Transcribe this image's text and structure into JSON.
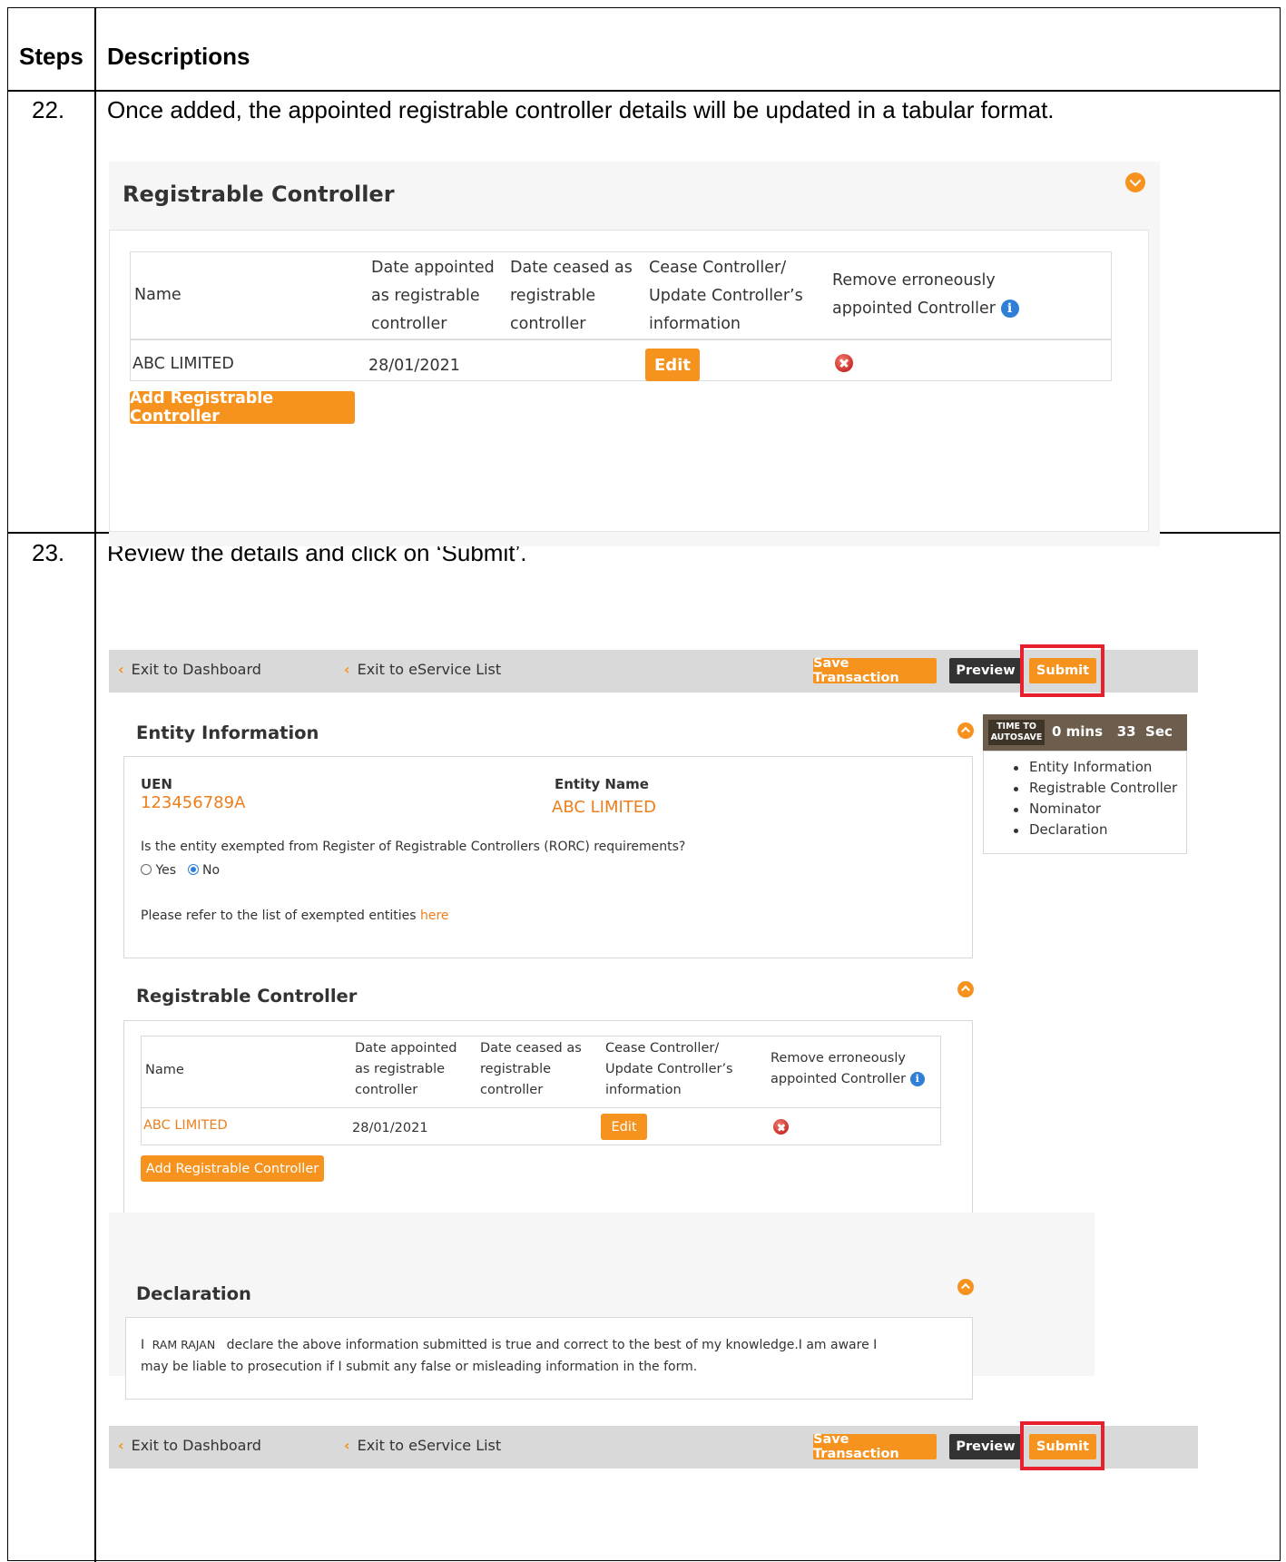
{
  "table": {
    "header_steps": "Steps",
    "header_descriptions": "Descriptions",
    "rows": [
      {
        "step": "22.",
        "description": "Once added, the appointed registrable controller details will be updated in a tabular format."
      },
      {
        "step": "23.",
        "description": "Review the details and click on ‘Submit’."
      }
    ]
  },
  "icons": {
    "collapse": "chevron-circle-icon",
    "remove": "red-cross-icon",
    "info": "info-icon",
    "nav": "chevron-left-icon"
  },
  "colors": {
    "accent": "#f6931e",
    "link": "#ec7f1d",
    "highlight": "#e8202e",
    "dark_button": "#333333"
  },
  "controller_table": {
    "section_title": "Registrable Controller",
    "columns": [
      "Name",
      "Date appointed as registrable controller",
      "Date ceased as registrable controller",
      "Cease Controller/ Update Controller’s information",
      "Remove erroneously appointed Controller"
    ],
    "col1_lines": [
      "Date appointed",
      "as registrable",
      "controller"
    ],
    "col2_lines": [
      "Date ceased as",
      "registrable",
      "controller"
    ],
    "col3_lines": [
      "Cease Controller/",
      "Update Controller’s",
      "information"
    ],
    "col4_lines": [
      "Remove erroneously",
      "appointed Controller"
    ],
    "rows": [
      {
        "name": "ABC LIMITED",
        "date_appointed": "28/01/2021",
        "date_ceased": "",
        "action_label": "Edit"
      }
    ],
    "add_button": "Add Registrable Controller"
  },
  "toolbar": {
    "exit_dashboard": "Exit to Dashboard",
    "exit_eservice": "Exit to eService List",
    "save": "Save Transaction",
    "preview": "Preview",
    "submit": "Submit"
  },
  "autosave": {
    "label_line1": "TIME TO",
    "label_line2": "AUTOSAVE",
    "time": "0 mins   33  Sec"
  },
  "sidebar_nav": [
    "Entity Information",
    "Registrable Controller",
    "Nominator",
    "Declaration"
  ],
  "entity_info": {
    "title": "Entity Information",
    "uen_label": "UEN",
    "uen_value": "123456789A",
    "name_label": "Entity Name",
    "name_value": "ABC LIMITED",
    "question": "Is the entity exempted from Register of Registrable Controllers (RORC) requirements?",
    "option_yes": "Yes",
    "option_no": "No",
    "selected": "No",
    "refer_text": "Please refer to the list of exempted entities",
    "refer_link": "here"
  },
  "declaration": {
    "title": "Declaration",
    "prefix": "I",
    "declarant": "RAM RAJAN",
    "line1": "declare the above information submitted is true and correct to the best of my knowledge.I am aware I",
    "line2": "may be liable to prosecution if I submit any false or misleading information in the form."
  }
}
